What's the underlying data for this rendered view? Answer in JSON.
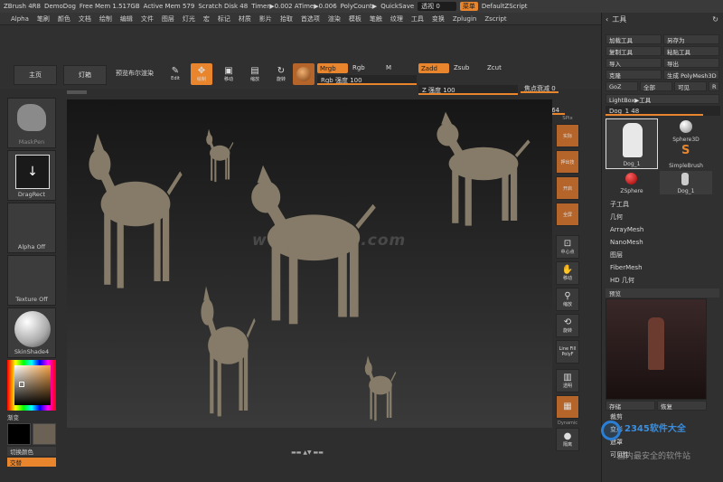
{
  "titlebar": {
    "app": "ZBrush 4R8",
    "doc": "DemoDog",
    "free_mem": "Free Mem 1.517GB",
    "active_mem": "Active Mem 579",
    "scratch": "Scratch Disk 48",
    "timer": "Timer▶0.002 ATime▶0.006",
    "polycount": "PolyCount▶",
    "quicksave": "QuickSave",
    "transparency": "透视  0",
    "menu": "菜单",
    "script": "DefaultZScript"
  },
  "menubar": [
    "Alpha",
    "笔刷",
    "颜色",
    "文档",
    "绘制",
    "编辑",
    "文件",
    "图层",
    "灯光",
    "宏",
    "标记",
    "材质",
    "影片",
    "拾取",
    "首选项",
    "渲染",
    "模板",
    "笔触",
    "纹理",
    "工具",
    "变换",
    "Zplugin",
    "Zscript"
  ],
  "toolbar": {
    "home": "主页",
    "lightbox": "灯箱",
    "preview_bool": "预览布尔渲染",
    "edit": "Edit",
    "draw": "绘制",
    "move": "移动",
    "scale": "缩放",
    "rotate": "旋转",
    "mrgb": "Mrgb",
    "rgb": "Rgb",
    "m": "M",
    "rgb_intensity": "Rgb 强度 100",
    "zadd": "Zadd",
    "zsub": "Zsub",
    "zcut": "Zcut",
    "z_intensity": "Z 强度 100",
    "focal": "焦点衰减 0",
    "draw_size": "绘制大小 64"
  },
  "leftshelf": {
    "brush": "MaskPen",
    "stroke": "DragRect",
    "alpha": "Alpha Off",
    "texture": "Texture Off",
    "material": "SkinShade4",
    "gradient": "渐变",
    "switch_color": "切换颜色",
    "alternate": "交替"
  },
  "rightshelf": {
    "spix": "SPix",
    "items": [
      "实际",
      "押出技",
      "开启",
      "全屏"
    ],
    "frame": "中心点",
    "move": "移动",
    "scale": "缩放",
    "rotate": "旋转",
    "linefill": "Line Fill",
    "polyf": "PolyF",
    "transp": "透明",
    "dynamic": "Dynamic",
    "solo": "隔离"
  },
  "watermark": "www.DuoTe.com",
  "tool": {
    "title": "工具",
    "buttons": [
      [
        "加载工具",
        "另存为"
      ],
      [
        "复制工具",
        "粘贴工具"
      ],
      [
        "导入",
        "导出"
      ],
      [
        "克隆",
        "生成 PolyMesh3D"
      ],
      [
        "GoZ",
        "全部",
        "可见",
        "R"
      ]
    ],
    "lightbox": "LightBox▶工具",
    "current": "Dog_1  48",
    "thumbs": [
      "Dog_1",
      "Sphere3D",
      "SimpleBrush",
      "ZSphere",
      "Dog_1"
    ],
    "sub": [
      "子工具",
      "几何",
      "ArrayMesh",
      "NanoMesh",
      "图层",
      "FiberMesh",
      "HD 几何"
    ],
    "preview": "预览",
    "preview_btns": [
      "存储",
      "恢复"
    ],
    "sub2": [
      "裁剪",
      "变形",
      "遮罩",
      "可见性"
    ]
  },
  "brand": {
    "text": "2345软件大全",
    "sub": "国内最安全的软件站"
  }
}
